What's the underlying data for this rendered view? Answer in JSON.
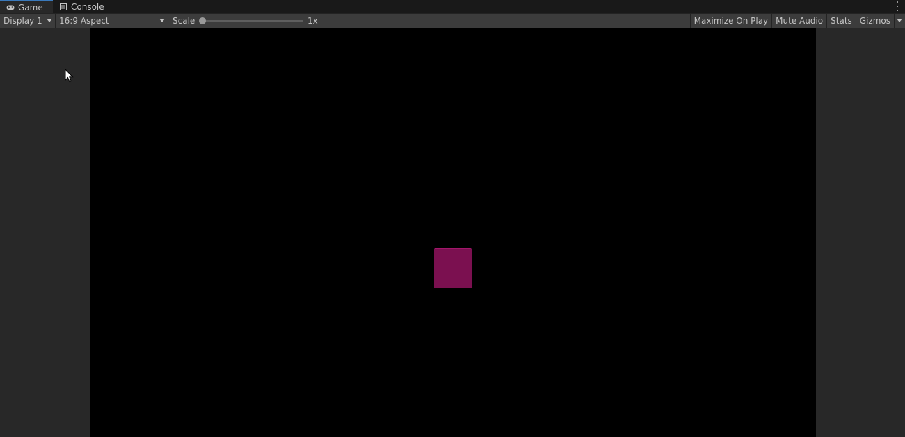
{
  "tabs": [
    {
      "label": "Game",
      "icon": "gamepad-icon",
      "active": true
    },
    {
      "label": "Console",
      "icon": "console-icon",
      "active": false
    }
  ],
  "toolbar": {
    "display_label": "Display 1",
    "aspect_label": "16:9 Aspect",
    "scale_label": "Scale",
    "scale_value": "1x",
    "maximize_label": "Maximize On Play",
    "mute_label": "Mute Audio",
    "stats_label": "Stats",
    "gizmos_label": "Gizmos"
  },
  "game_view": {
    "background": "#000000",
    "object_color": "#7b1050"
  },
  "colors": {
    "accent": "#3a79bb",
    "panel": "#282828",
    "toolbar": "#3c3c3c"
  }
}
